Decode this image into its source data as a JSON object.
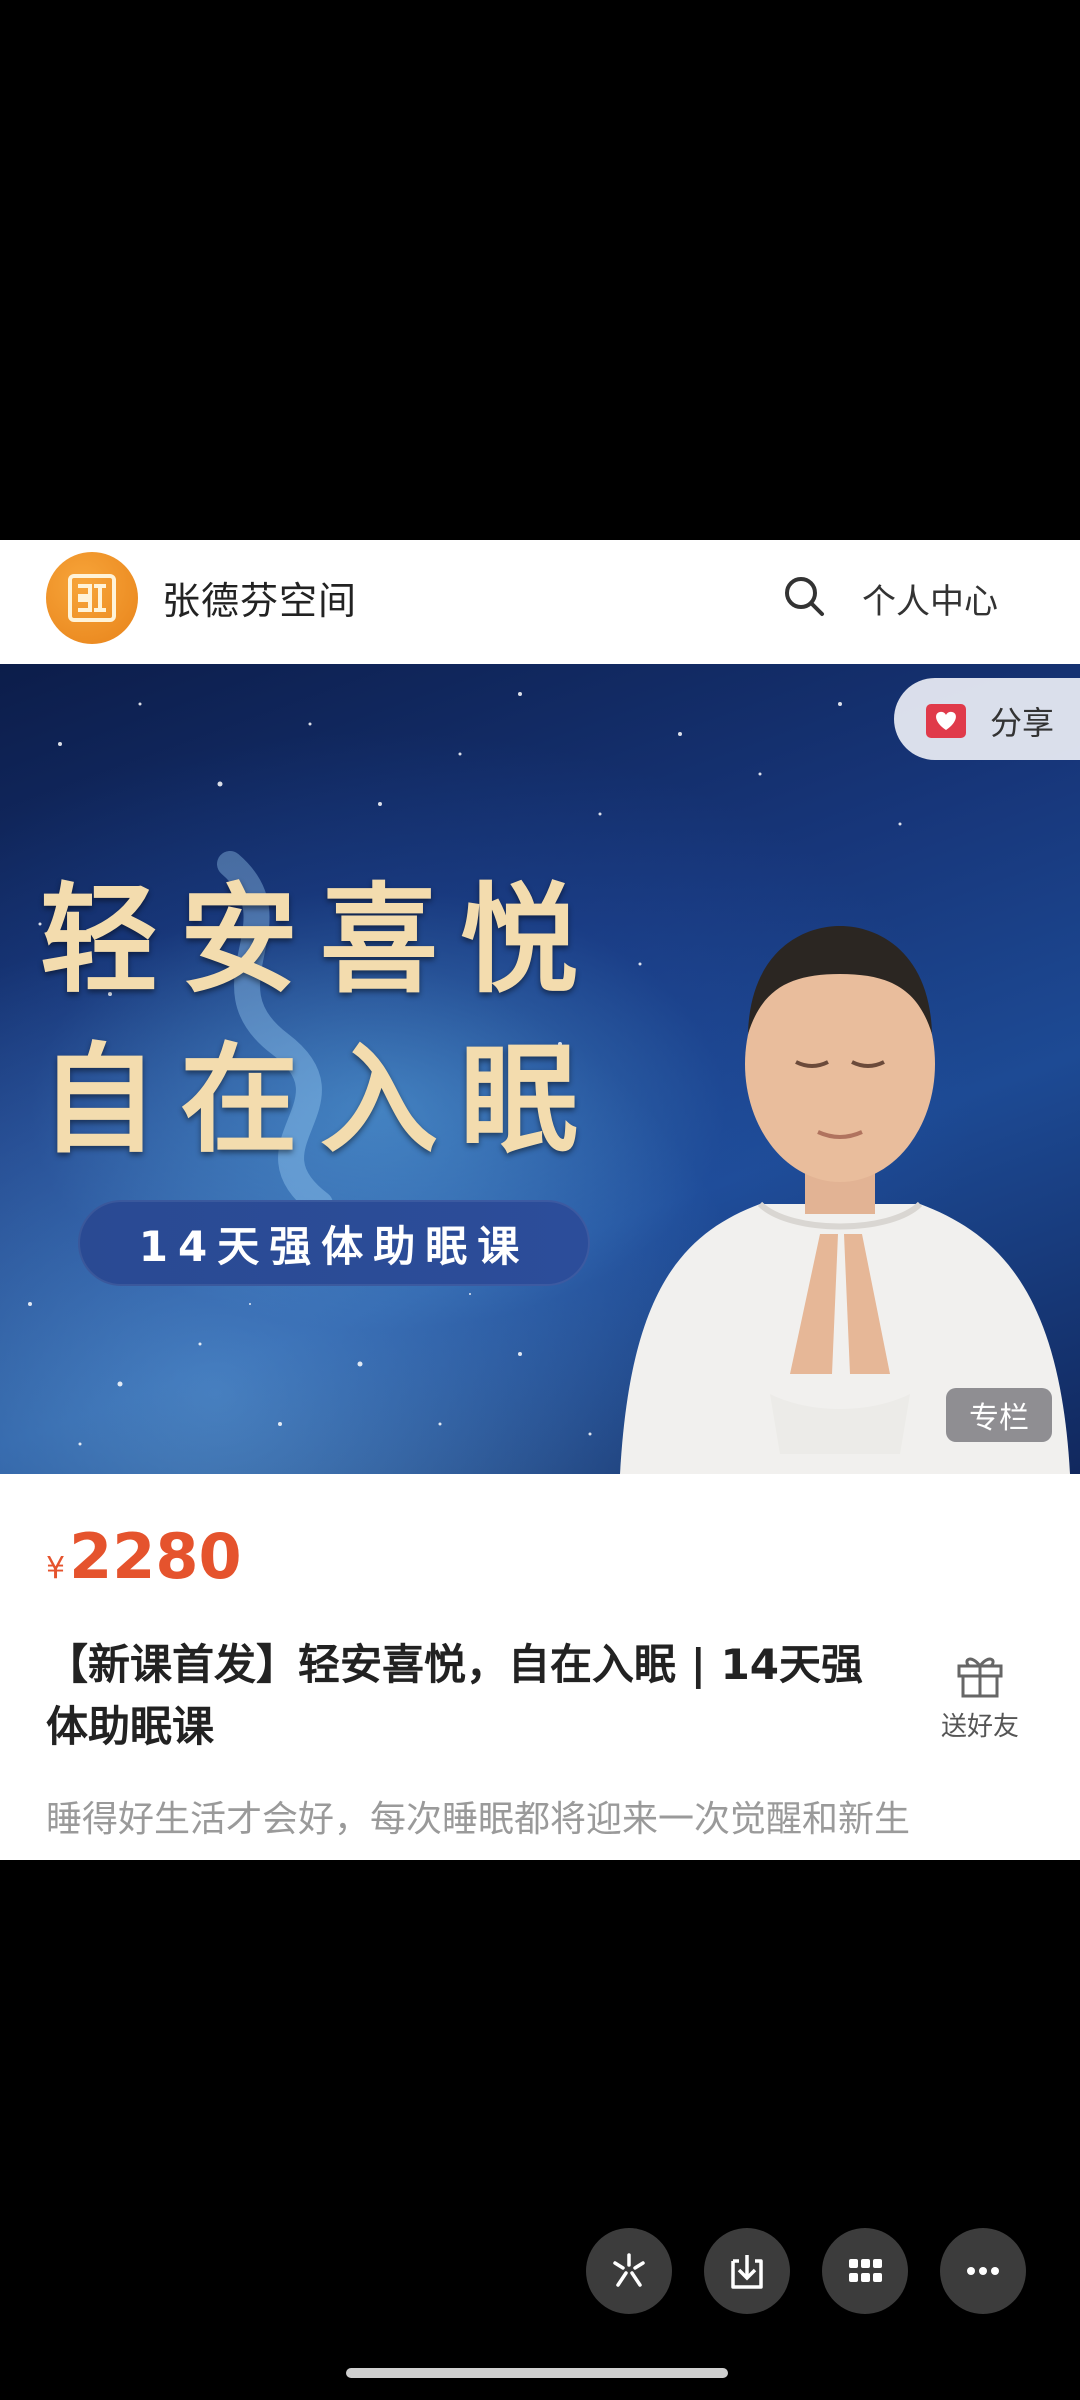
{
  "header": {
    "site_name": "张德芬空间",
    "personal_center": "个人中心",
    "logo_icon": "zdf-logo-icon",
    "search_icon": "search-icon"
  },
  "banner": {
    "share_label": "分享",
    "title_line1": "轻安喜悦",
    "title_line2": "自在入眠",
    "course_label": "14天强体助眠课",
    "column_tag": "专栏"
  },
  "product": {
    "currency": "¥",
    "price": "2280",
    "title": "【新课首发】轻安喜悦，自在入眠 | 14天强体助眠课",
    "subtitle": "睡得好生活才会好，每次睡眠都将迎来一次觉醒和新生",
    "gift_label": "送好友"
  },
  "floating_actions": [
    {
      "icon": "sparkle-icon"
    },
    {
      "icon": "download-icon"
    },
    {
      "icon": "grid-icon"
    },
    {
      "icon": "more-icon"
    }
  ],
  "colors": {
    "price": "#e5532d",
    "logo_orange": "#f0901f",
    "banner_title": "#f3dcae"
  }
}
